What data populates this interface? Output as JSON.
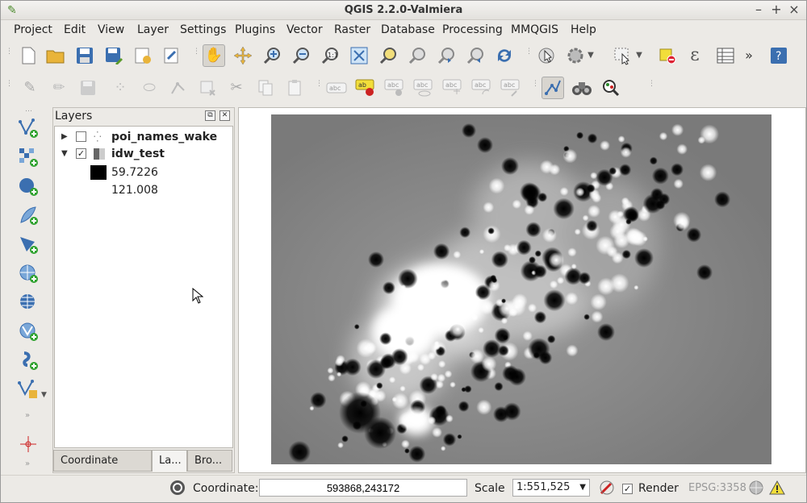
{
  "window": {
    "title": "QGIS 2.2.0-Valmiera",
    "minimize": "–",
    "maximize": "+",
    "close": "×"
  },
  "menu": [
    "Project",
    "Edit",
    "View",
    "Layer",
    "Settings",
    "Plugins",
    "Vector",
    "Raster",
    "Database",
    "Processing",
    "MMQGIS",
    "Help"
  ],
  "toolbar": {
    "overflow": "»"
  },
  "layers_panel": {
    "title": "Layers",
    "layers": [
      {
        "name": "poi_names_wake",
        "checked": false,
        "expanded": false
      },
      {
        "name": "idw_test",
        "checked": true,
        "expanded": true,
        "legend": [
          {
            "label": "59.7226",
            "color": "#000000"
          },
          {
            "label": "121.008",
            "color": "#ffffff"
          }
        ]
      }
    ],
    "tabs": [
      "Coordinate Cap...",
      "La...",
      "Bro..."
    ],
    "active_tab": 1
  },
  "status": {
    "coordinate_label": "Coordinate:",
    "coordinate_value": "593868,243172",
    "scale_label": "Scale",
    "scale_value": "1:551,525",
    "render_label": "Render",
    "render_checked": true,
    "crs": "EPSG:3358"
  },
  "colors": {
    "accent": "#3b6fb0",
    "raster_background": "#7a7a7a"
  }
}
